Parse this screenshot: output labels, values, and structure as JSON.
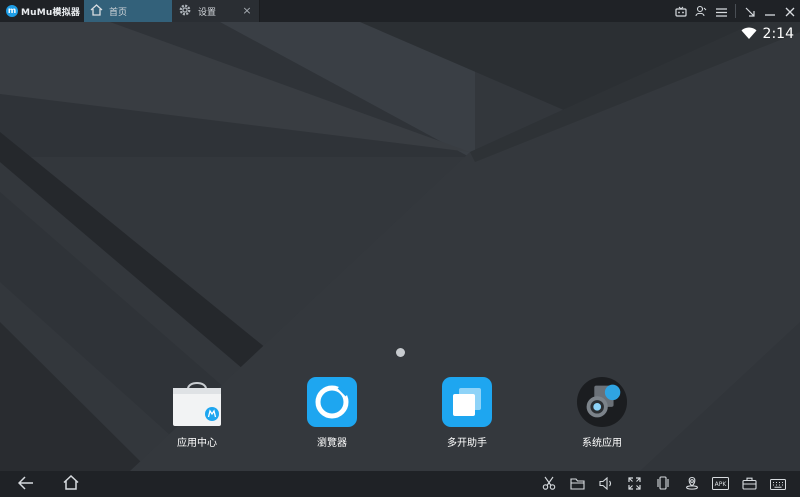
{
  "app": {
    "title": "MuMu模拟器"
  },
  "tabs": [
    {
      "label": "首页",
      "icon": "home-icon",
      "active": true
    },
    {
      "label": "设置",
      "icon": "gear-icon",
      "active": false,
      "close": "×"
    }
  ],
  "titlebar_buttons": [
    "tv-icon",
    "user-icon",
    "menu-icon",
    "shrink-icon",
    "minimize-icon",
    "close-icon"
  ],
  "status": {
    "time": "2:14",
    "wifi": "wifi-icon"
  },
  "home": {
    "pages": 1,
    "apps": [
      {
        "label": "应用中心",
        "icon": "app-center-icon",
        "badge_text": "MuMu"
      },
      {
        "label": "瀏覽器",
        "icon": "browser-icon"
      },
      {
        "label": "多开助手",
        "icon": "multi-open-icon"
      },
      {
        "label": "系统应用",
        "icon": "system-apps-icon"
      }
    ]
  },
  "bottom_nav": [
    "back-icon",
    "home-icon"
  ],
  "toolbar": [
    "screenshot-scissors-icon",
    "folder-icon",
    "volume-icon",
    "fullscreen-icon",
    "shake-icon",
    "location-icon",
    "apk-icon",
    "toolbox-icon",
    "keyboard-icon"
  ],
  "toolbar_text": {
    "apk": "APK"
  },
  "colors": {
    "titlebar": "#1f2226",
    "active_tab": "#33617a",
    "wallpaper": "#33373c",
    "accent_blue": "#1ea6f0"
  }
}
